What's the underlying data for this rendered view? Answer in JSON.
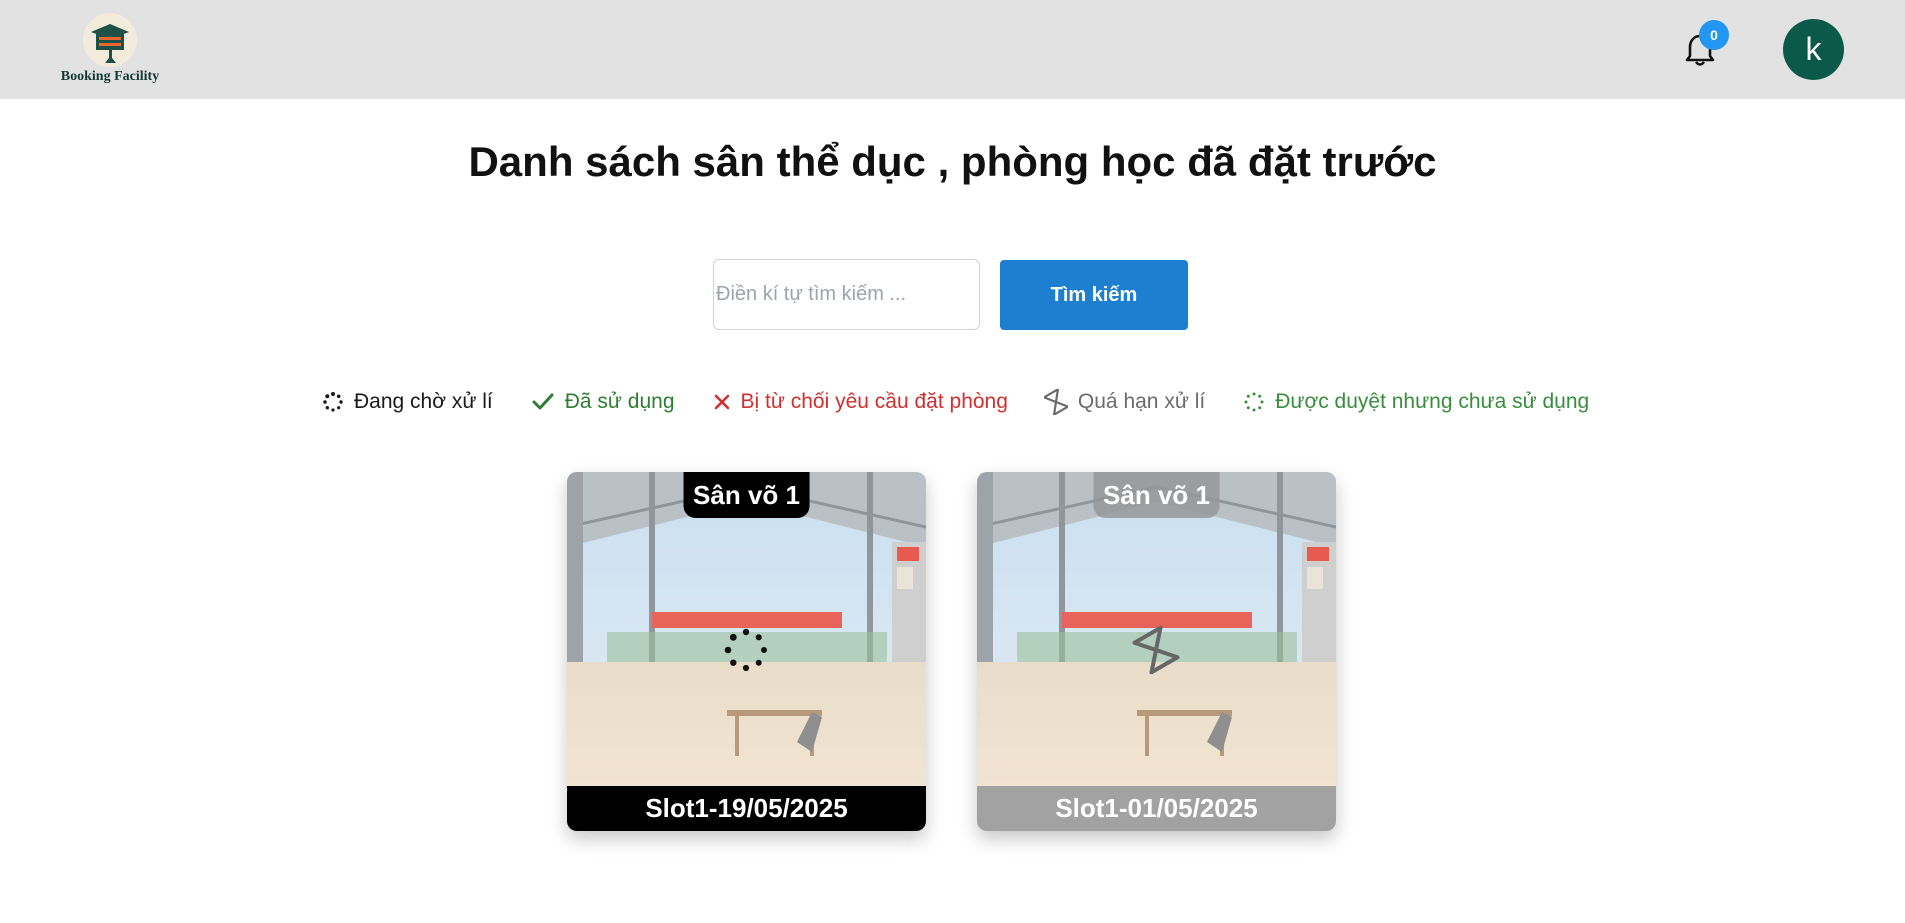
{
  "header": {
    "logo_text": "Booking Facility",
    "notification_count": "0",
    "avatar_initial": "k"
  },
  "main": {
    "title": "Danh sách sân thể dục , phòng học đã đặt trước",
    "search": {
      "placeholder": "Điền kí tự tìm kiếm ...",
      "value": "",
      "button_label": "Tìm kiếm"
    },
    "legend": [
      {
        "label": "Đang chờ xử lí",
        "icon": "spinner-icon",
        "color": "#1a1a1a"
      },
      {
        "label": "Đã sử dụng",
        "icon": "check-icon",
        "color": "#2e7d32"
      },
      {
        "label": "Bị từ chối yêu cầu đặt phòng",
        "icon": "close-icon",
        "color": "#d32f2f"
      },
      {
        "label": "Quá hạn xử lí",
        "icon": "hourglass-icon",
        "color": "#6b6b6b"
      },
      {
        "label": "Được duyệt nhưng chưa sử dụng",
        "icon": "dotted-spinner-icon",
        "color": "#388e3c"
      }
    ],
    "bookings": [
      {
        "facility": "Sân võ 1",
        "slot": "Slot1-19/05/2025",
        "status_icon": "spinner-icon"
      },
      {
        "facility": "Sân võ 1",
        "slot": "Slot1-01/05/2025",
        "status_icon": "hourglass-icon"
      }
    ]
  },
  "colors": {
    "header_bg": "#e2e2e2",
    "primary_button": "#1e7fd0",
    "avatar_bg": "#0b5a49",
    "badge_bg": "#2196f3"
  }
}
